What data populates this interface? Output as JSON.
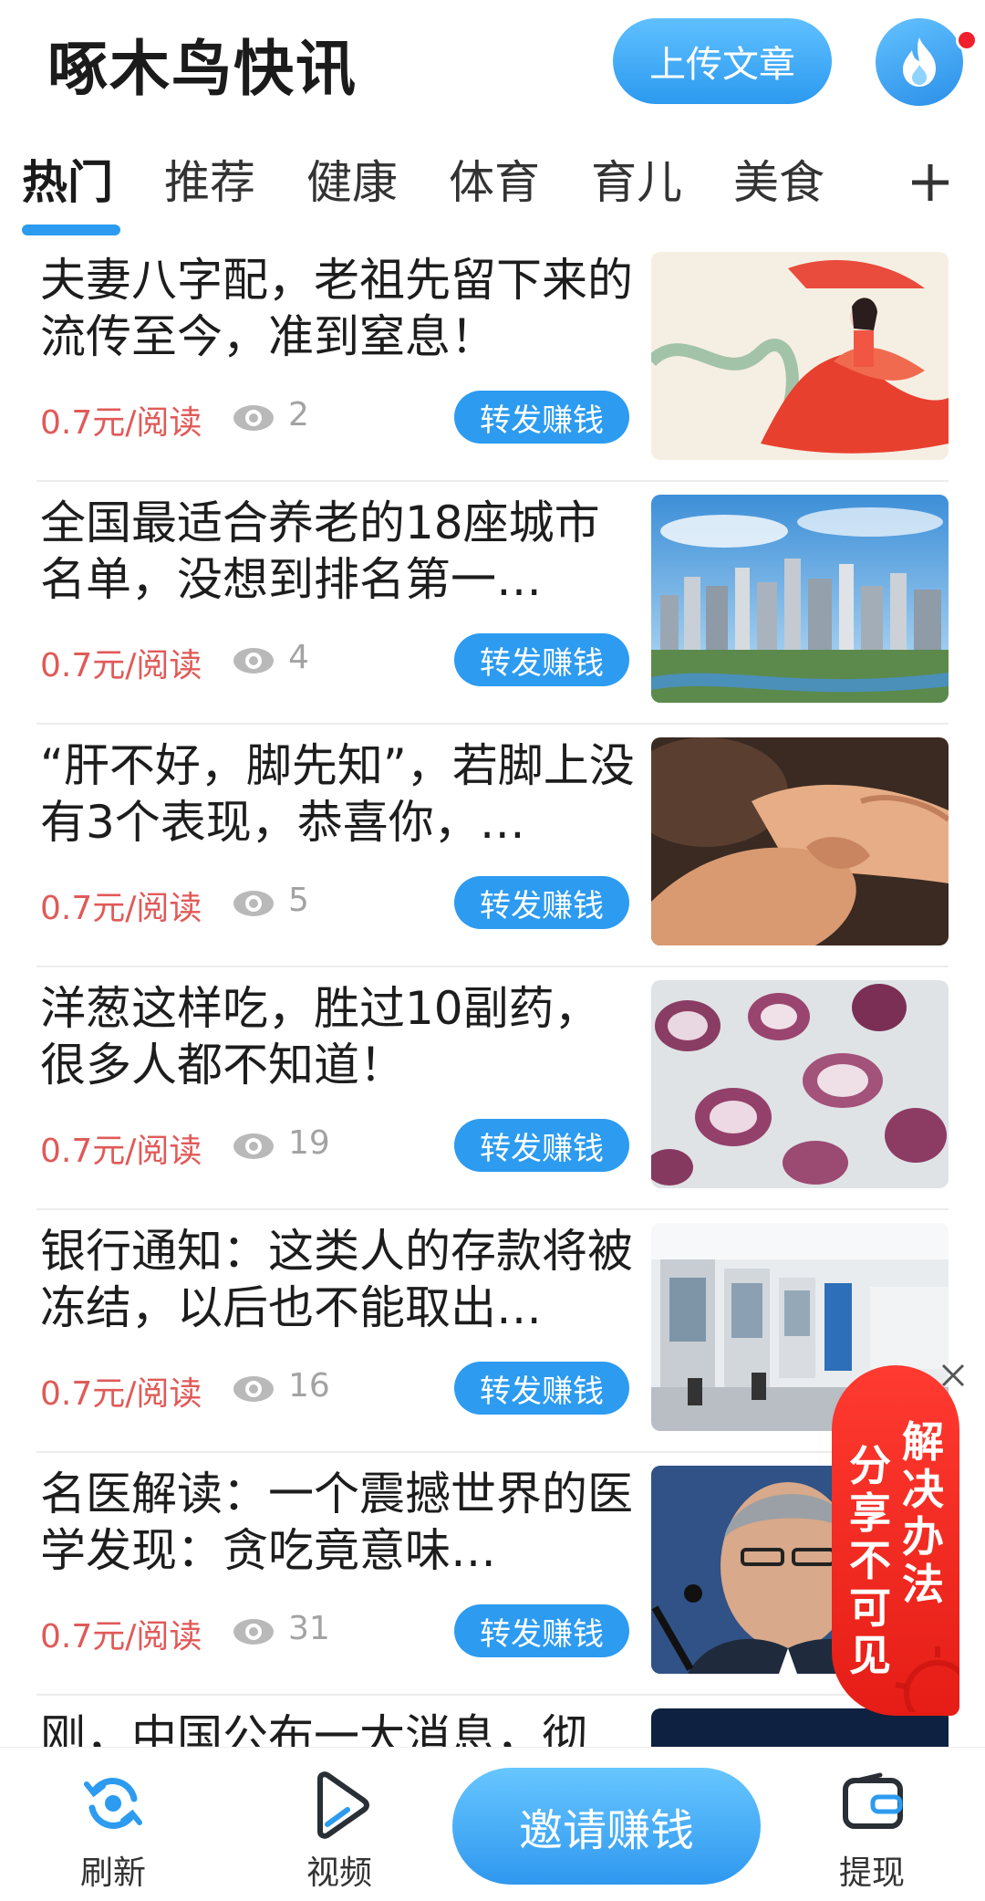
{
  "header": {
    "title": "啄木鸟快讯",
    "upload_label": "上传文章",
    "avatar_icon": "flame-icon",
    "notification_color": "#f0202c"
  },
  "tabs": {
    "items": [
      {
        "label": "热门",
        "active": true
      },
      {
        "label": "推荐",
        "active": false
      },
      {
        "label": "健康",
        "active": false
      },
      {
        "label": "体育",
        "active": false
      },
      {
        "label": "育儿",
        "active": false
      },
      {
        "label": "美食",
        "active": false
      }
    ],
    "add_icon": "plus-icon",
    "accent": "#2c9bf0"
  },
  "feed": {
    "items": [
      {
        "title": "夫妻八字配，老祖先留下来的流传至今，准到窒息！",
        "price": "0.7元/阅读",
        "views": "2",
        "share_label": "转发赚钱",
        "image": "painting-red-dress-lady"
      },
      {
        "title": "全国最适合养老的18座城市名单，没想到排名第一…",
        "price": "0.7元/阅读",
        "views": "4",
        "share_label": "转发赚钱",
        "image": "city-skyline"
      },
      {
        "title": "“肝不好，脚先知”，若脚上没有3个表现，恭喜你，…",
        "price": "0.7元/阅读",
        "views": "5",
        "share_label": "转发赚钱",
        "image": "foot-massage"
      },
      {
        "title": "洋葱这样吃，胜过10副药，很多人都不知道！",
        "price": "0.7元/阅读",
        "views": "19",
        "share_label": "转发赚钱",
        "image": "red-onions"
      },
      {
        "title": "银行通知：这类人的存款将被冻结，以后也不能取出…",
        "price": "0.7元/阅读",
        "views": "16",
        "share_label": "转发赚钱",
        "image": "bank-counters"
      },
      {
        "title": "名医解读：一个震撼世界的医学发现：贪吃竟意味…",
        "price": "0.7元/阅读",
        "views": "31",
        "share_label": "转发赚钱",
        "image": "doctor-portrait"
      },
      {
        "title": "刚，中国公布一大消息，彻",
        "price": "",
        "views": "",
        "share_label": "",
        "image": "dark-photo"
      }
    ],
    "price_color": "#e05a58"
  },
  "floating_badge": {
    "col_right": "解决办法",
    "col_left": "分享不可见",
    "close_icon": "close-icon"
  },
  "bottom_bar": {
    "refresh_label": "刷新",
    "video_label": "视频",
    "invite_label": "邀请赚钱",
    "withdraw_label": "提现"
  }
}
